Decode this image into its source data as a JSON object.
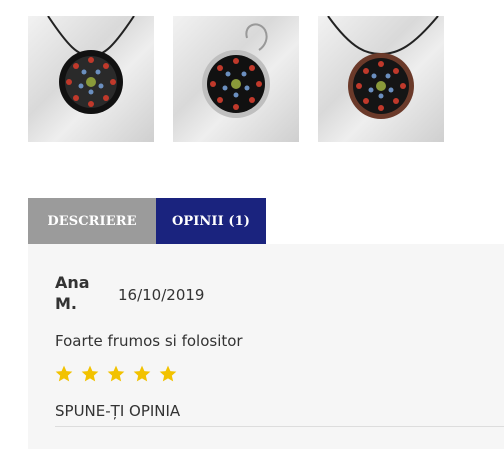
{
  "gallery": {
    "thumbnails": [
      "pendant-photo-1",
      "pendant-photo-2",
      "pendant-photo-3"
    ]
  },
  "tabs": [
    {
      "label": "DESCRIERE",
      "active": false
    },
    {
      "label": "OPINII (1)",
      "active": true
    }
  ],
  "review": {
    "author": "Ana M.",
    "date": "16/10/2019",
    "text": "Foarte frumos si folositor",
    "rating": 5,
    "rating_max": 5
  },
  "cta_label": "SPUNE-ȚI OPINIA",
  "colors": {
    "tab_active": "#1a237e",
    "tab_inactive": "#9b9b9b",
    "star": "#f2c200",
    "panel_bg": "#f6f6f6"
  }
}
